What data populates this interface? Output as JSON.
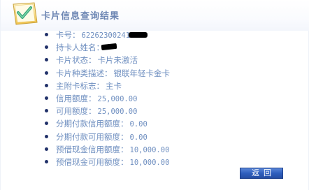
{
  "header": {
    "title": "卡片信息查询结果",
    "icon": "checkmark-badge-icon"
  },
  "info": [
    {
      "label": "卡号：",
      "value": "62262300241"
    },
    {
      "label": "持卡人姓名：",
      "value": ""
    },
    {
      "label": "卡片状态：",
      "value": "卡片未激活"
    },
    {
      "label": "卡片种类描述：",
      "value": "银联年轻卡金卡"
    },
    {
      "label": "主附卡标志：",
      "value": "主卡"
    },
    {
      "label": "信用额度：",
      "value": "25,000.00"
    },
    {
      "label": "可用额度：",
      "value": "25,000.00"
    },
    {
      "label": "分期付款信用额度：",
      "value": "0.00"
    },
    {
      "label": "分期付款可用额度：",
      "value": "0.00"
    },
    {
      "label": "预借现金信用额度：",
      "value": "10,000.00"
    },
    {
      "label": "预借现金可用额度：",
      "value": "10,000.00"
    }
  ],
  "actions": {
    "back_label": "返回"
  },
  "colors": {
    "title": "#6d86b3",
    "text": "#6f8fc0",
    "bullet": "#22326a",
    "button": "#2f5fbe"
  }
}
